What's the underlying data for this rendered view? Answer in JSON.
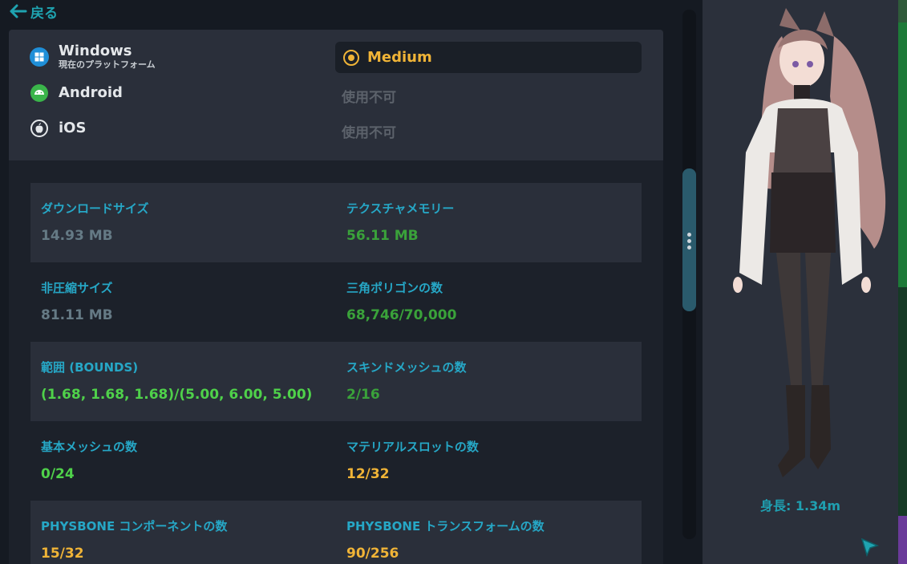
{
  "nav": {
    "back_label": "戻る"
  },
  "platforms": [
    {
      "name": "Windows",
      "sub": "現在のプラットフォーム",
      "icon": "windows-icon",
      "status": "Medium"
    },
    {
      "name": "Android",
      "sub": "",
      "icon": "android-icon",
      "status": "使用不可"
    },
    {
      "name": "iOS",
      "sub": "",
      "icon": "apple-icon",
      "status": "使用不可"
    }
  ],
  "stats": [
    {
      "label": "ダウンロードサイズ",
      "value": "14.93 MB",
      "color": "#657a85"
    },
    {
      "label": "テクスチャメモリー",
      "value": "56.11 MB",
      "color": "#3aa23a"
    },
    {
      "label": "非圧縮サイズ",
      "value": "81.11 MB",
      "color": "#657a85"
    },
    {
      "label": "三角ポリゴンの数",
      "value": "68,746/70,000",
      "color": "#3aa23a"
    },
    {
      "label": "範囲 (BOUNDS)",
      "value": "(1.68, 1.68, 1.68)/(5.00, 6.00, 5.00)",
      "color": "#4fd14a"
    },
    {
      "label": "スキンドメッシュの数",
      "value": "2/16",
      "color": "#3aa23a"
    },
    {
      "label": "基本メッシュの数",
      "value": "0/24",
      "color": "#4fd14a"
    },
    {
      "label": "マテリアルスロットの数",
      "value": "12/32",
      "color": "#f0b437"
    },
    {
      "label": "PHYSBONE コンポーネントの数",
      "value": "15/32",
      "color": "#f0b437"
    },
    {
      "label": "PHYSBONE トランスフォームの数",
      "value": "90/256",
      "color": "#f0b437"
    }
  ],
  "avatar": {
    "height_label": "身長: 1.34m"
  },
  "colors": {
    "accent": "#1fa3b0",
    "medium": "#f0b437",
    "good": "#4fd14a",
    "neutral": "#657a85"
  }
}
